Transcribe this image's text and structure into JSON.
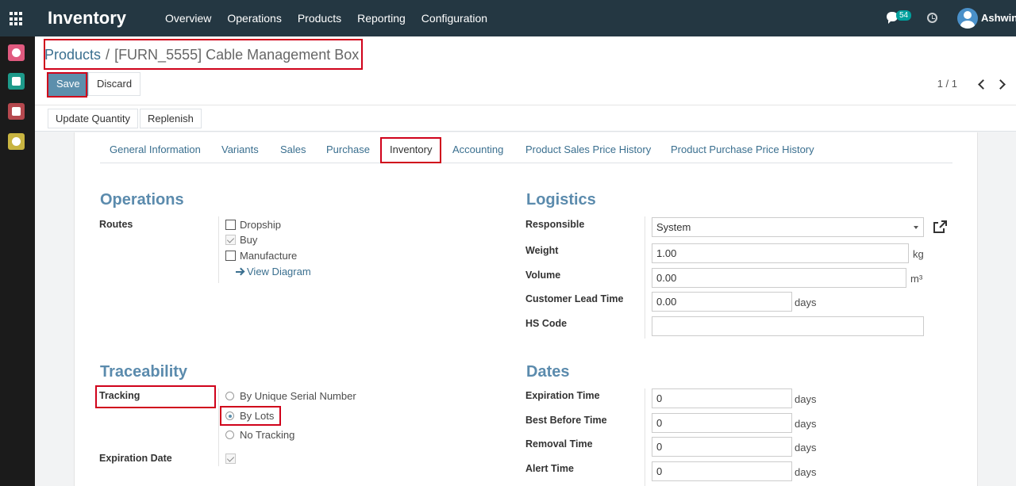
{
  "app": {
    "title": "Inventory"
  },
  "main_menu": [
    "Overview",
    "Operations",
    "Products",
    "Reporting",
    "Configuration"
  ],
  "systray": {
    "message_count": "54",
    "user_name": "Ashwin",
    "icons": [
      "chat-icon",
      "clock-icon",
      "avatar"
    ]
  },
  "sidebar": {
    "apps": [
      {
        "icon": "chat-bubble-icon",
        "color": "#e05a7f"
      },
      {
        "icon": "contacts-icon",
        "color": "#1d9a8a"
      },
      {
        "icon": "box-icon",
        "color": "#b5484e"
      },
      {
        "icon": "gear-icon",
        "color": "#c8b441"
      }
    ]
  },
  "breadcrumb": {
    "parent": "Products",
    "separator": "/",
    "current": "[FURN_5555] Cable Management Box"
  },
  "buttons": {
    "save": "Save",
    "discard": "Discard",
    "update_quantity": "Update Quantity",
    "replenish": "Replenish"
  },
  "pager": {
    "value": "1 / 1"
  },
  "tabs": [
    "General Information",
    "Variants",
    "Sales",
    "Purchase",
    "Inventory",
    "Accounting",
    "Product Sales Price History",
    "Product Purchase Price History"
  ],
  "active_tab": "Inventory",
  "operations": {
    "title": "Operations",
    "routes_label": "Routes",
    "routes": [
      {
        "label": "Dropship",
        "checked": false
      },
      {
        "label": "Buy",
        "checked": true
      },
      {
        "label": "Manufacture",
        "checked": false
      }
    ],
    "view_diagram": "View Diagram"
  },
  "logistics": {
    "title": "Logistics",
    "responsible": {
      "label": "Responsible",
      "value": "System"
    },
    "weight": {
      "label": "Weight",
      "value": "1.00",
      "unit": "kg"
    },
    "volume": {
      "label": "Volume",
      "value": "0.00",
      "unit": "m³"
    },
    "lead_time": {
      "label": "Customer Lead Time",
      "value": "0.00",
      "unit": "days"
    },
    "hs_code": {
      "label": "HS Code",
      "value": ""
    }
  },
  "traceability": {
    "title": "Traceability",
    "tracking_label": "Tracking",
    "options": [
      {
        "label": "By Unique Serial Number",
        "selected": false
      },
      {
        "label": "By Lots",
        "selected": true
      },
      {
        "label": "No Tracking",
        "selected": false
      }
    ],
    "expiration_date_label": "Expiration Date",
    "expiration_date_checked": true
  },
  "dates": {
    "title": "Dates",
    "expiration_time": {
      "label": "Expiration Time",
      "value": "0",
      "unit": "days"
    },
    "best_before_time": {
      "label": "Best Before Time",
      "value": "0",
      "unit": "days"
    },
    "removal_time": {
      "label": "Removal Time",
      "value": "0",
      "unit": "days"
    },
    "alert_time": {
      "label": "Alert Time",
      "value": "0",
      "unit": "days"
    }
  },
  "colors": {
    "navbar": "#243742",
    "primary": "#5c8fac",
    "link": "#3a6f8f",
    "section_title": "#5b8bad",
    "highlight": "#d0021b"
  }
}
